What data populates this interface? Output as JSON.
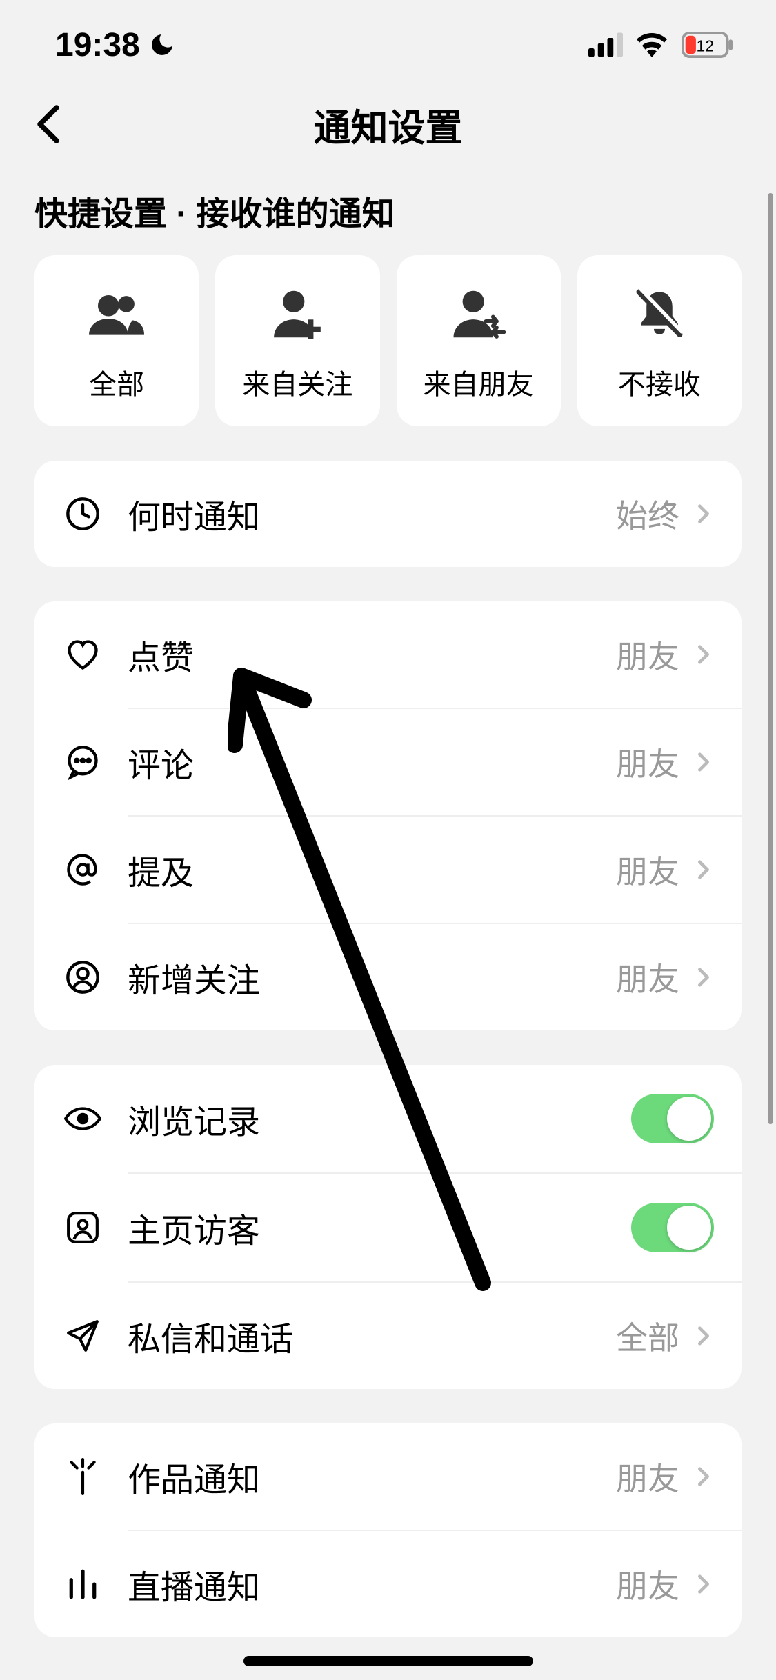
{
  "status": {
    "time": "19:38",
    "battery": "12"
  },
  "header": {
    "title": "通知设置"
  },
  "section_label": "快捷设置 · 接收谁的通知",
  "quick": [
    {
      "label": "全部"
    },
    {
      "label": "来自关注"
    },
    {
      "label": "来自朋友"
    },
    {
      "label": "不接收"
    }
  ],
  "rows": {
    "when": {
      "label": "何时通知",
      "value": "始终"
    },
    "like": {
      "label": "点赞",
      "value": "朋友"
    },
    "comment": {
      "label": "评论",
      "value": "朋友"
    },
    "mention": {
      "label": "提及",
      "value": "朋友"
    },
    "follow": {
      "label": "新增关注",
      "value": "朋友"
    },
    "history": {
      "label": "浏览记录"
    },
    "visitor": {
      "label": "主页访客"
    },
    "dm": {
      "label": "私信和通话",
      "value": "全部"
    },
    "works": {
      "label": "作品通知",
      "value": "朋友"
    },
    "live": {
      "label": "直播通知",
      "value": "朋友"
    }
  }
}
